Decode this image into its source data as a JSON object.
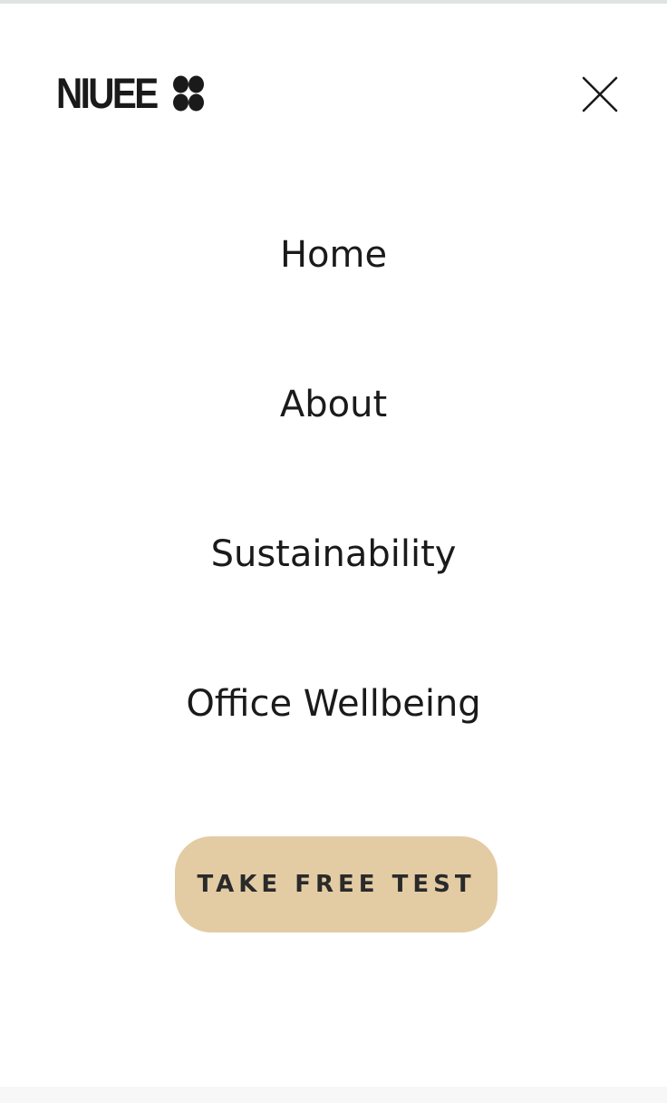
{
  "brand": {
    "name": "NIUEE",
    "logo_icon": "four-circles-logo-mark"
  },
  "header": {
    "close_icon": "close-icon"
  },
  "menu": {
    "items": [
      {
        "label": "Home"
      },
      {
        "label": "About"
      },
      {
        "label": "Sustainability"
      },
      {
        "label": "Office Wellbeing"
      }
    ]
  },
  "cta": {
    "label": "TAKE FREE TEST",
    "background_color": "#e3cca4"
  },
  "colors": {
    "text": "#1a1a1a",
    "background": "#ffffff"
  }
}
